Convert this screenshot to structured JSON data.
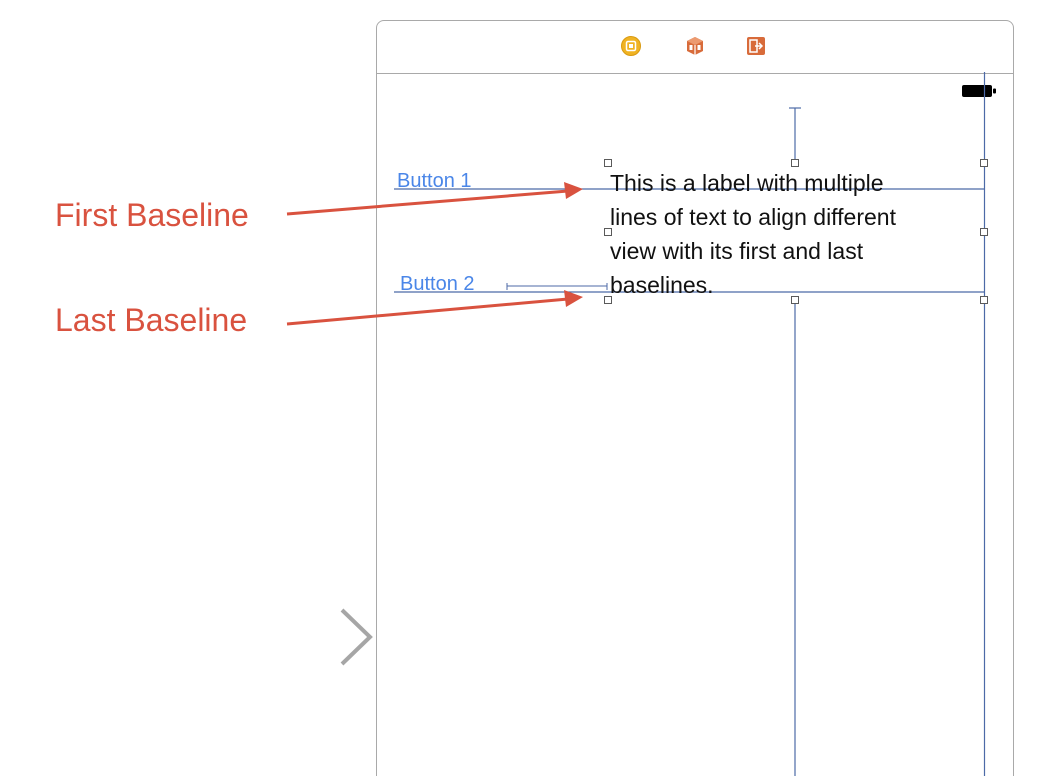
{
  "colors": {
    "annotation": "#d9523f",
    "button_text": "#4a86e8",
    "constraint_line": "#4c6aa7",
    "arrow_gray": "#a6a6a6",
    "frame_border": "#a9a9a9",
    "scene_icon_yellow": "#f0b323",
    "scene_icon_orange": "#d86b3a"
  },
  "scene_dock": {
    "icons": [
      "view-controller-icon",
      "first-responder-icon",
      "exit-icon"
    ]
  },
  "status_bar": {
    "icon": "battery-icon"
  },
  "buttons": {
    "button1_label": "Button 1",
    "button2_label": "Button 2"
  },
  "label": {
    "text": "This is a label with multiple\nlines of text to align different\nview with its first and last\nbaselines."
  },
  "annotations": {
    "first_baseline": "First Baseline",
    "last_baseline": "Last Baseline"
  },
  "entry_point": {
    "icon": "entry-point-arrow-icon"
  }
}
